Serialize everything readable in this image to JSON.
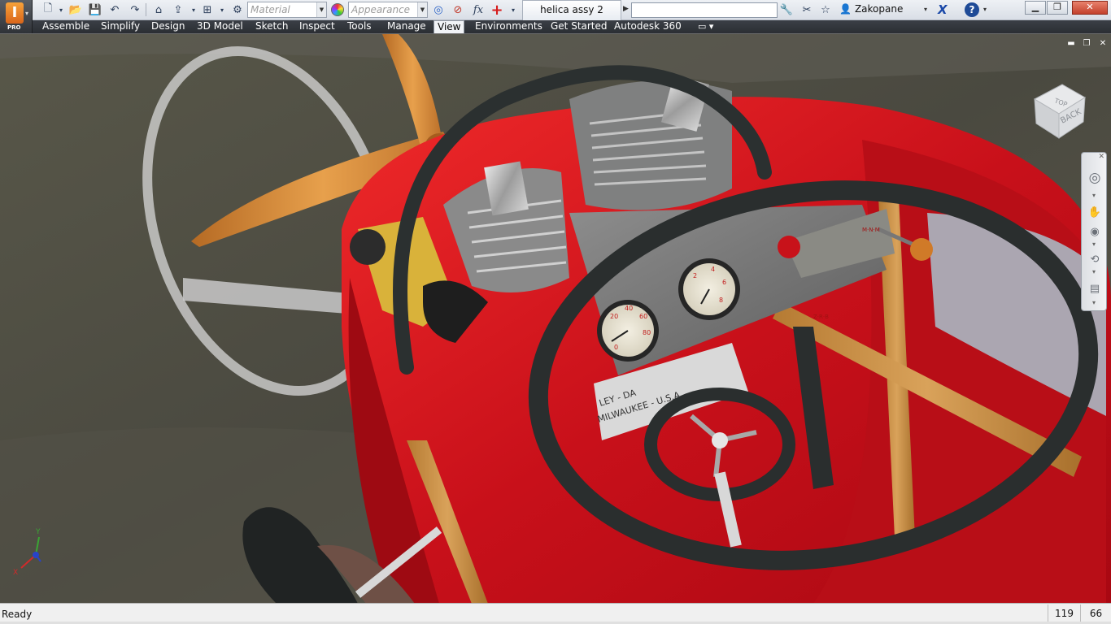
{
  "app": {
    "product_badge": "PRO",
    "document_tab": "helica assy 2",
    "material_placeholder": "Material",
    "appearance_placeholder": "Appearance",
    "formula_label": "fx",
    "user_name": "Zakopane"
  },
  "ribbon": {
    "tabs": [
      "Assemble",
      "Simplify",
      "Design",
      "3D Model",
      "Sketch",
      "Inspect",
      "Tools",
      "Manage",
      "View",
      "Environments",
      "Get Started",
      "Autodesk 360"
    ],
    "active_tab": "View"
  },
  "viewcube": {
    "top_label": "TOP",
    "back_label": "BACK"
  },
  "triad": {
    "y_label": "Y",
    "x_label": "X"
  },
  "scene": {
    "plate_text_1": "LEY - DA",
    "plate_text_2": "MILWAUKEE - U.S.A.",
    "gauge_1": [
      "20",
      "40",
      "60",
      "80",
      "0"
    ],
    "gauge_2": [
      "2",
      "4",
      "6",
      "8"
    ],
    "lever_text_1": "M·N·M",
    "lever_text_2": "Z·R·B"
  },
  "status": {
    "text": "Ready",
    "count_1": "119",
    "count_2": "66"
  },
  "colors": {
    "ribbon_bg": "#2f3237",
    "body_red": "#d4121b",
    "propeller_orange": "#d58a3a",
    "wheel_dark": "#2a2e2e",
    "ground": "#4e4d44"
  }
}
